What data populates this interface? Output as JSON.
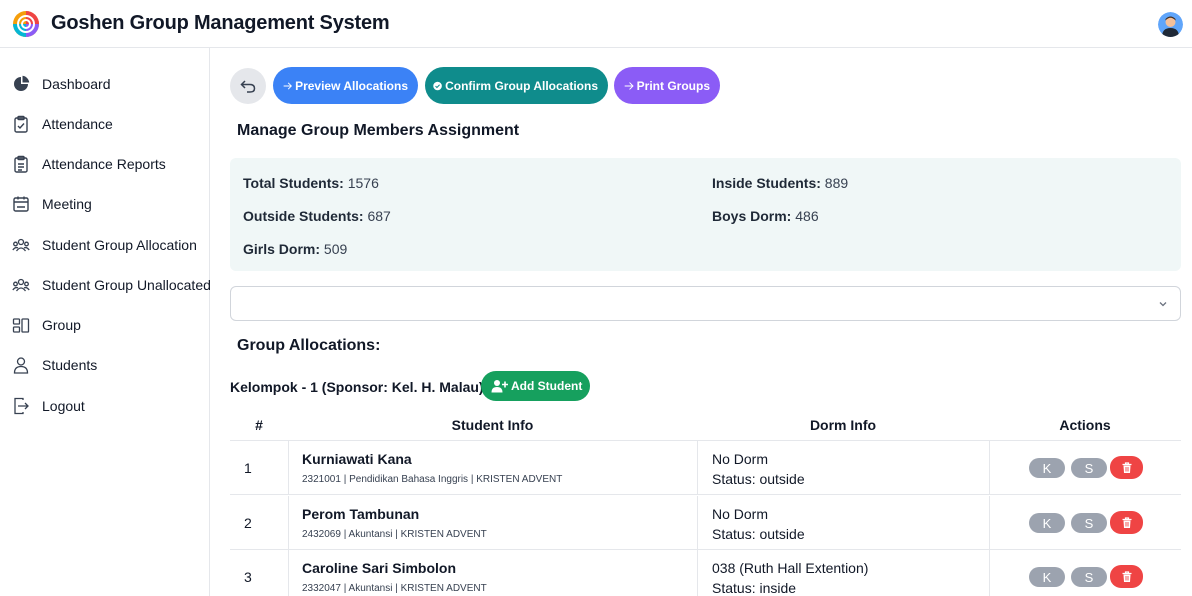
{
  "app": {
    "title": "Goshen Group Management System"
  },
  "sidebar": {
    "items": [
      {
        "label": "Dashboard",
        "icon": "pie-chart-icon"
      },
      {
        "label": "Attendance",
        "icon": "clipboard-check-icon"
      },
      {
        "label": "Attendance Reports",
        "icon": "clipboard-list-icon"
      },
      {
        "label": "Meeting",
        "icon": "calendar-icon"
      },
      {
        "label": "Student Group Allocation",
        "icon": "users-icon"
      },
      {
        "label": "Student Group Unallocated",
        "icon": "users-icon"
      },
      {
        "label": "Group",
        "icon": "grid-icon"
      },
      {
        "label": "Students",
        "icon": "user-icon"
      },
      {
        "label": "Logout",
        "icon": "logout-icon"
      }
    ]
  },
  "toolbar": {
    "preview_label": "Preview Allocations",
    "confirm_label": "Confirm Group Allocations",
    "print_label": "Print Groups"
  },
  "main": {
    "section_title": "Manage Group Members Assignment",
    "group_allocations_title": "Group Allocations:"
  },
  "stats": {
    "total_label": "Total Students:",
    "total_value": "1576",
    "inside_label": "Inside Students:",
    "inside_value": "889",
    "outside_label": "Outside Students:",
    "outside_value": "687",
    "boys_label": "Boys Dorm:",
    "boys_value": "486",
    "girls_label": "Girls Dorm:",
    "girls_value": "509"
  },
  "group": {
    "title": "Kelompok - 1 (Sponsor: Kel. H. Malau)",
    "add_label": "Add Student"
  },
  "table": {
    "headers": [
      "#",
      "Student Info",
      "Dorm Info",
      "Actions"
    ],
    "rows": [
      {
        "num": "1",
        "name": "Kurniawati Kana",
        "meta": "2321001 | Pendidikan Bahasa Inggris | KRISTEN ADVENT",
        "dorm": "No Dorm",
        "status": "Status: outside",
        "k": "K",
        "s": "S"
      },
      {
        "num": "2",
        "name": "Perom Tambunan",
        "meta": "2432069 | Akuntansi | KRISTEN ADVENT",
        "dorm": "No Dorm",
        "status": "Status: outside",
        "k": "K",
        "s": "S"
      },
      {
        "num": "3",
        "name": "Caroline Sari Simbolon",
        "meta": "2332047 | Akuntansi | KRISTEN ADVENT",
        "dorm": "038 (Ruth Hall Extention)",
        "status": "Status: inside",
        "k": "K",
        "s": "S"
      }
    ]
  },
  "colors": {
    "preview": "#3b82f6",
    "confirm": "#0f8c8c",
    "print": "#8b5cf6",
    "add": "#16a05e",
    "delete": "#ef4444",
    "stats_bg": "#f0f7f7"
  }
}
